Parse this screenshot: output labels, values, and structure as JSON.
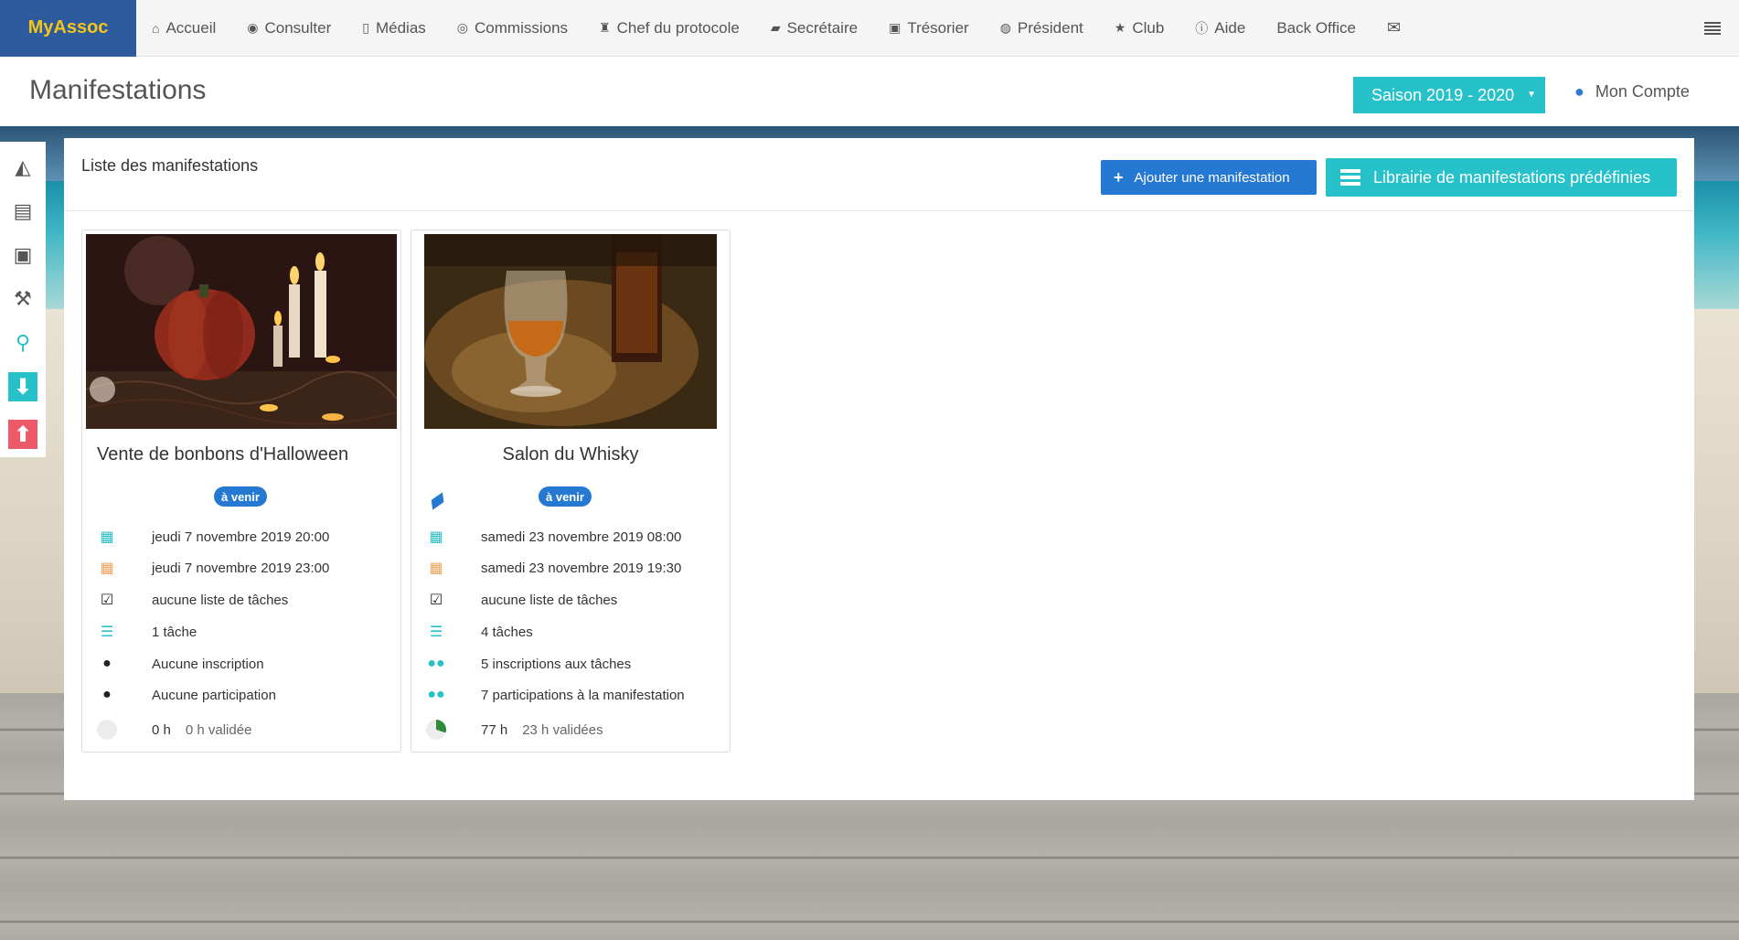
{
  "brand": "MyAssoc",
  "nav": [
    {
      "label": "Accueil",
      "icon": "home-icon",
      "glyph": "⌂"
    },
    {
      "label": "Consulter",
      "icon": "eye-icon",
      "glyph": "◉"
    },
    {
      "label": "Médias",
      "icon": "file-icon",
      "glyph": "▯"
    },
    {
      "label": "Commissions",
      "icon": "user-circle-icon",
      "glyph": "◎"
    },
    {
      "label": "Chef du protocole",
      "icon": "trophy-icon",
      "glyph": "♜"
    },
    {
      "label": "Secrétaire",
      "icon": "book-icon",
      "glyph": "▰"
    },
    {
      "label": "Trésorier",
      "icon": "money-icon",
      "glyph": "▣"
    },
    {
      "label": "Président",
      "icon": "globe-icon",
      "glyph": "◍"
    },
    {
      "label": "Club",
      "icon": "star-icon",
      "glyph": "★"
    },
    {
      "label": "Aide",
      "icon": "info-icon",
      "glyph": "ⓘ"
    },
    {
      "label": "Back Office",
      "icon": "",
      "glyph": ""
    },
    {
      "label": "",
      "icon": "envelope-icon",
      "glyph": "✉"
    }
  ],
  "header": {
    "title": "Manifestations",
    "season": "Saison 2019 - 2020",
    "account": "Mon Compte"
  },
  "sidebar": [
    {
      "icon": "area-chart-icon",
      "glyph": "◭"
    },
    {
      "icon": "document-icon",
      "glyph": "▤"
    },
    {
      "icon": "money-icon",
      "glyph": "▣"
    },
    {
      "icon": "wrench-icon",
      "glyph": "⚒"
    },
    {
      "icon": "map-marker-icon",
      "glyph": "⚲"
    },
    {
      "icon": "download-icon",
      "glyph": "⬇"
    },
    {
      "icon": "upload-icon",
      "glyph": "⬆"
    }
  ],
  "panel": {
    "title": "Liste des manifestations",
    "add_button": "Ajouter une manifestation",
    "library_button": "Librairie de manifestations prédéfinies"
  },
  "events": [
    {
      "name": "Vente de bonbons d'Halloween",
      "status": "à venir",
      "start": "jeudi 7 novembre 2019 20:00",
      "end": "jeudi 7 novembre 2019 23:00",
      "task_list": "aucune liste de tâches",
      "tasks": "1 tâche",
      "registrations": "Aucune inscription",
      "participations": "Aucune participation",
      "hours": "0 h",
      "validated": "0 h validée",
      "validated_fraction": 0
    },
    {
      "name": "Salon du Whisky",
      "status": "à venir",
      "start": "samedi 23 novembre 2019 08:00",
      "end": "samedi 23 novembre 2019 19:30",
      "task_list": "aucune liste de tâches",
      "tasks": "4 tâches",
      "registrations": "5 inscriptions aux tâches",
      "participations": "7 participations à la manifestation",
      "hours": "77 h",
      "validated": "23 h validées",
      "validated_fraction": 0.3
    }
  ],
  "colors": {
    "brand_bg": "#2d5b9e",
    "brand_text": "#f5c518",
    "primary": "#2679d3",
    "teal": "#26c1c9",
    "danger": "#ec5a6a",
    "orange": "#f0a35a"
  }
}
